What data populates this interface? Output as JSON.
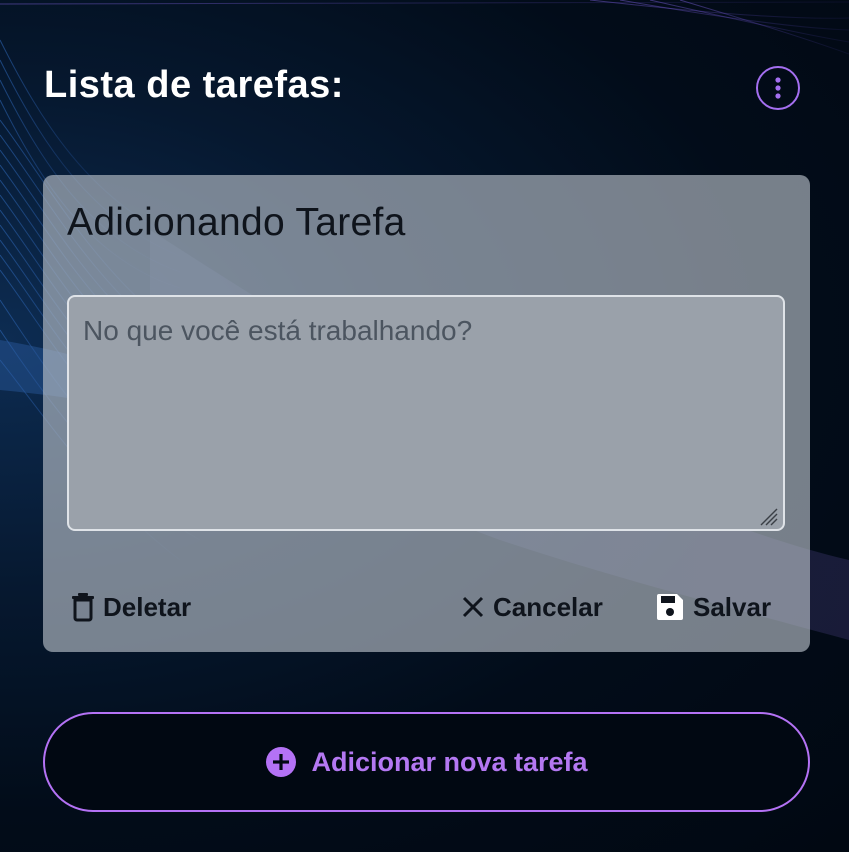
{
  "header": {
    "title": "Lista de tarefas:",
    "menu_icon": "kebab-menu-icon"
  },
  "card": {
    "title": "Adicionando Tarefa",
    "textarea": {
      "value": "",
      "placeholder": "No que você está trabalhando?"
    },
    "actions": {
      "delete_label": "Deletar",
      "delete_icon": "trash-icon",
      "cancel_label": "Cancelar",
      "cancel_icon": "close-icon",
      "save_label": "Salvar",
      "save_icon": "floppy-disk-icon"
    }
  },
  "add_task": {
    "label": "Adicionar nova tarefa",
    "icon": "plus-circle-icon"
  },
  "colors": {
    "accent": "#b472f5",
    "background": "#010b17",
    "card": "#9ea5ae",
    "text_dark": "#0f141c",
    "text_light": "#ffffff"
  }
}
